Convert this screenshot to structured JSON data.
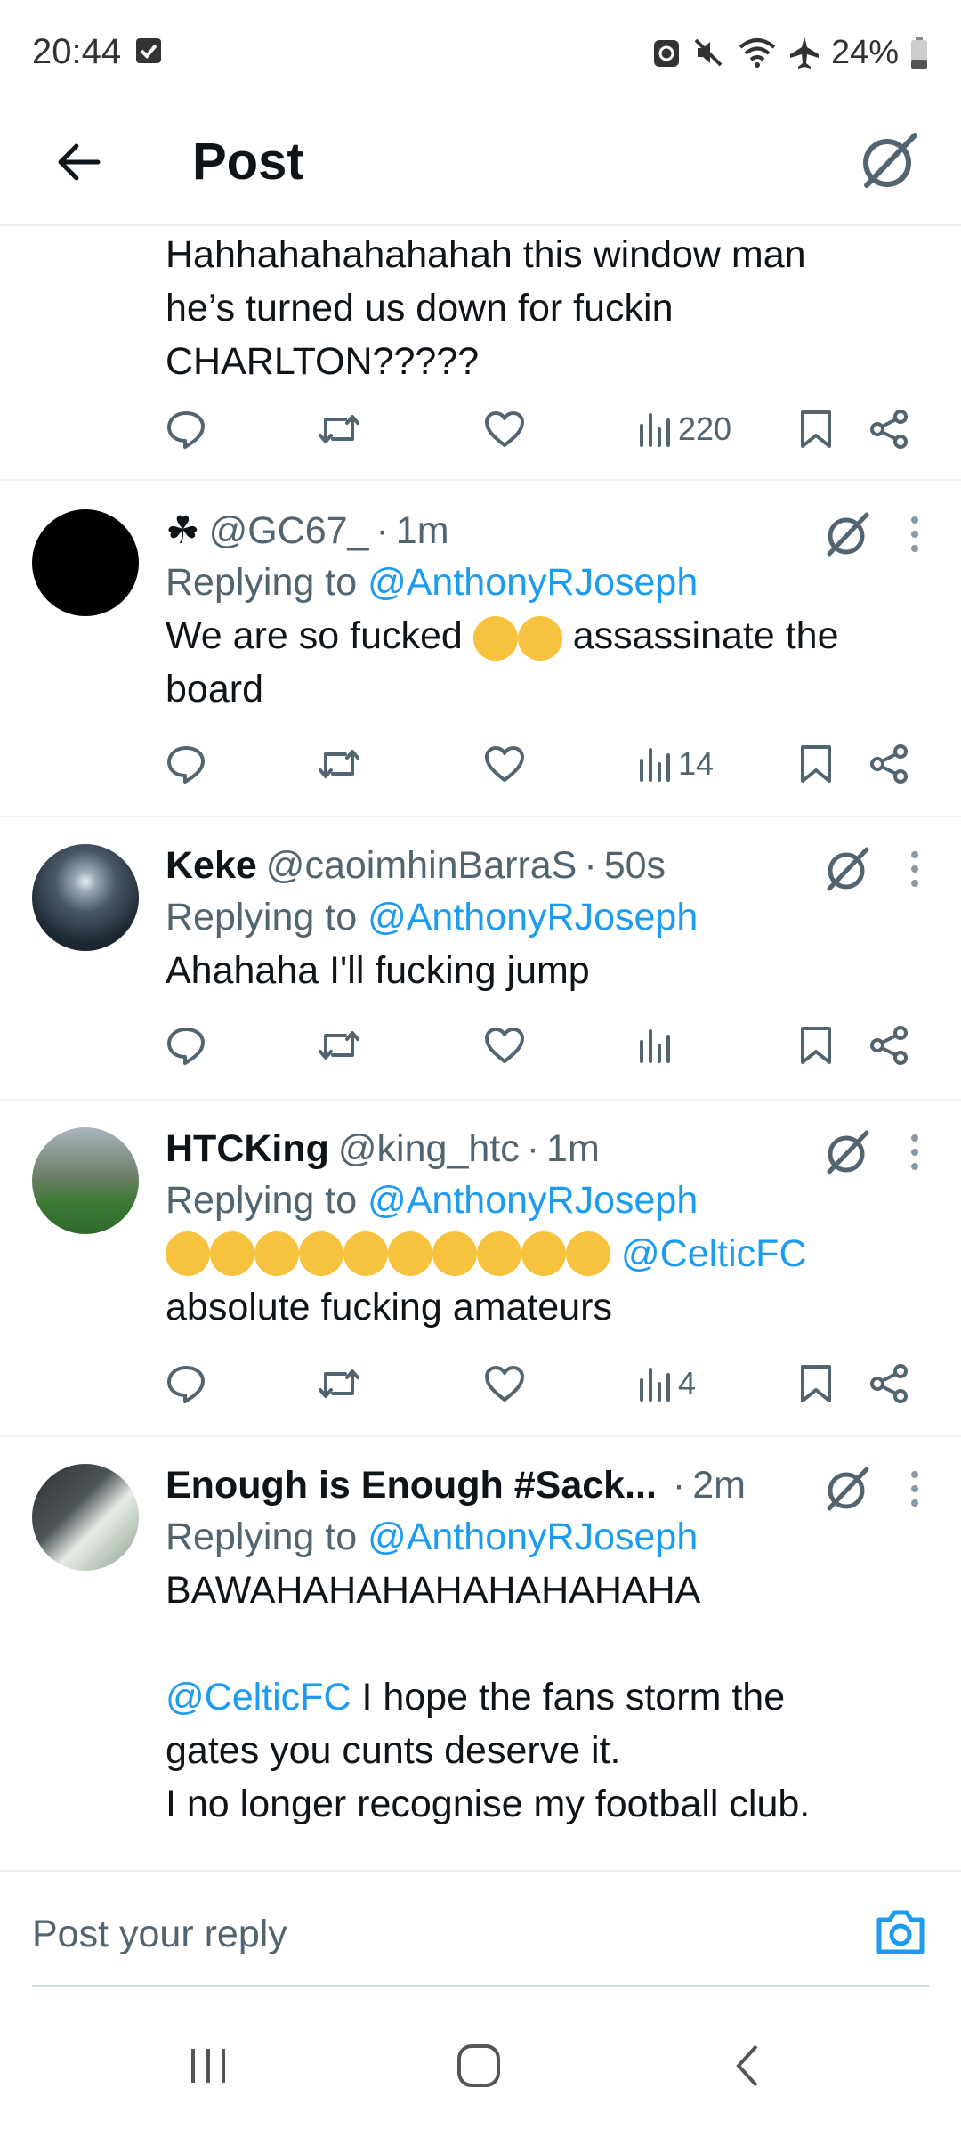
{
  "status_bar": {
    "time": "20:44",
    "battery": "24%"
  },
  "header": {
    "title": "Post"
  },
  "main_post": {
    "text_lines": [
      "Hahhahahahahahah this window man",
      "he’s turned us down for fuckin",
      "CHARLTON?????"
    ],
    "views": "220"
  },
  "replies": [
    {
      "name": "☘",
      "handle": "@GC67_",
      "time": "1m",
      "replying_label": "Replying to",
      "replying_to": "@AnthonyRJoseph",
      "text_line1_a": "We are so fucked ",
      "text_line1_b": " assassinate the",
      "text_line2": "board",
      "views": "14"
    },
    {
      "name": "Keke",
      "handle": "@caoimhinBarraS",
      "time": "50s",
      "replying_label": "Replying to",
      "replying_to": "@AnthonyRJoseph",
      "text_line1": "Ahahaha I'll fucking jump",
      "views": ""
    },
    {
      "name": "HTCKing",
      "handle": "@king_htc",
      "time": "1m",
      "replying_label": "Replying to",
      "replying_to": "@AnthonyRJoseph",
      "mention": "@CelticFC",
      "text_line2": "absolute fucking amateurs",
      "views": "4"
    },
    {
      "name": "Enough is Enough #Sack...",
      "time": "2m",
      "replying_label": "Replying to",
      "replying_to": "@AnthonyRJoseph",
      "text_line1": "BAWAHAHAHAHAHAHAHAHA",
      "mention": "@CelticFC",
      "text_line3_rest": " I hope the fans storm the",
      "text_line4": "gates you cunts deserve it.",
      "text_line5": "I no longer recognise my football club."
    }
  ],
  "reply_bar": {
    "placeholder": "Post your reply"
  },
  "icons": {
    "back": "arrow-left-icon",
    "grok": "grok-icon",
    "reply": "reply-icon",
    "retweet": "retweet-icon",
    "like": "heart-icon",
    "views": "views-icon",
    "bookmark": "bookmark-icon",
    "share": "share-icon",
    "camera": "camera-icon"
  },
  "colors": {
    "accent": "#1d9bf0",
    "secondary_text": "#536471",
    "divider": "#eff3f4"
  }
}
